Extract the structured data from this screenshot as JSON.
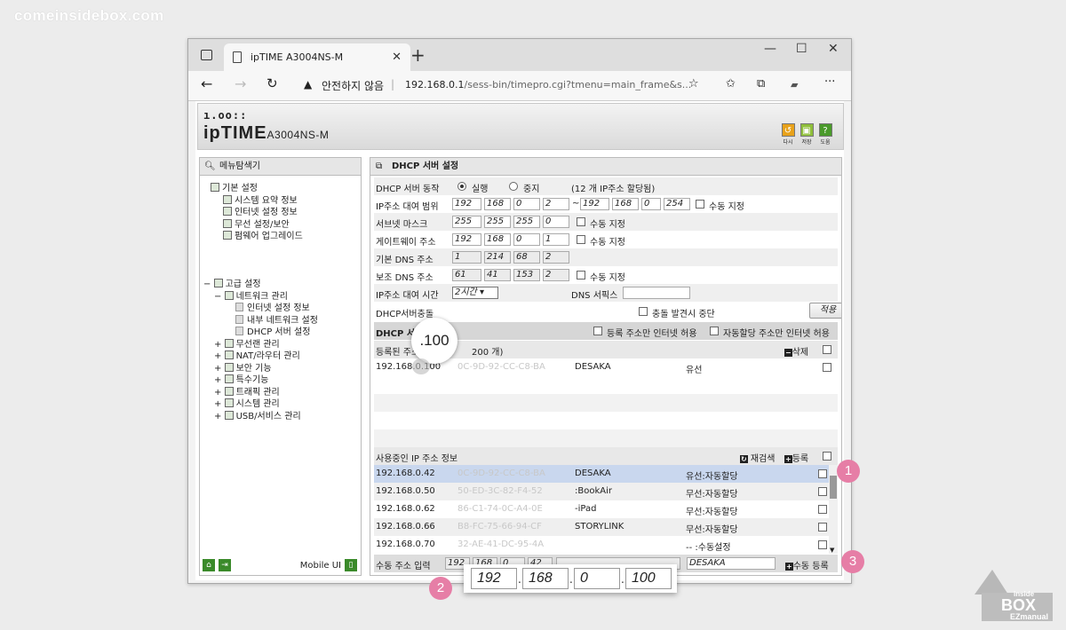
{
  "watermark": "comeinsidebox.com",
  "browser": {
    "tab_title": "ipTIME A3004NS-M",
    "insecure": "안전하지 않음",
    "url_host": "192.168.0.1",
    "url_path": "/sess-bin/timepro.cgi?tmenu=main_frame&s..."
  },
  "header": {
    "logo_top": "ı.oo::",
    "logo_brand": "ipTIME",
    "logo_model": "A3004NS-M",
    "buttons": [
      "다시",
      "저장",
      "도움"
    ]
  },
  "left_panel": {
    "title": "메뉴탐색기",
    "basic": {
      "label": "기본 설정",
      "items": [
        "시스템 요약 정보",
        "인터넷 설정 정보",
        "무선 설정/보안",
        "펌웨어 업그레이드"
      ]
    },
    "advanced": {
      "label": "고급 설정",
      "network": "네트워크 관리",
      "network_items": [
        "인터넷 설정 정보",
        "내부 네트워크 설정",
        "DHCP 서버 설정"
      ],
      "others": [
        "무선랜 관리",
        "NAT/라우터 관리",
        "보안 기능",
        "특수기능",
        "트래픽 관리",
        "시스템 관리",
        "USB/서비스 관리"
      ]
    },
    "mobile": "Mobile UI"
  },
  "right_panel": {
    "title": "DHCP 서버 설정",
    "rows": {
      "dhcp_server": "DHCP 서버 동작",
      "run": "실행",
      "stop": "중지",
      "ip_count": "(12 개 IP주소 할당됨)",
      "range": "IP주소 대여 범위",
      "range_start": [
        "192",
        "168",
        "0",
        "2"
      ],
      "range_end": [
        "192",
        "168",
        "0",
        "254"
      ],
      "manual": "수동 지정",
      "subnet": "서브넷 마스크",
      "subnet_val": [
        "255",
        "255",
        "255",
        "0"
      ],
      "gateway": "게이트웨이 주소",
      "gateway_val": [
        "192",
        "168",
        "0",
        "1"
      ],
      "dns1": "기본 DNS 주소",
      "dns1_val": [
        "1",
        "214",
        "68",
        "2"
      ],
      "dns2": "보조 DNS 주소",
      "dns2_val": [
        "61",
        "41",
        "153",
        "2"
      ],
      "lease": "IP주소 대여 시간",
      "lease_val": "2시간",
      "dns_suffix": "DNS 서픽스",
      "conflict": "DHCP서버충돌",
      "conflict_stop": "충돌 발견시 중단",
      "apply": "적용"
    },
    "band": {
      "left": "DHCP 서버",
      "only_reg": "등록 주소만 인터넷 허용",
      "only_auto": "자동할당 주소만 인터넷 허용"
    },
    "registered": {
      "header_a": "등록된 주소",
      "header_b": "200 개)",
      "delete": "삭제",
      "rows": [
        {
          "ip": "192.168.0.100",
          "mac": "0C-9D-92-CC-C8-BA",
          "name": "DESAKA",
          "type": "유선"
        }
      ]
    },
    "in_use": {
      "title": "사용중인 IP 주소 정보",
      "rescan": "재검색",
      "register": "등록",
      "rows": [
        {
          "ip": "192.168.0.42",
          "mac": "0C-9D-92-CC-C8-BA",
          "name": "DESAKA",
          "type": "유선:자동할당"
        },
        {
          "ip": "192.168.0.50",
          "mac": "50-ED-3C-82-F4-52",
          "name": "Dekaleo-MacBookAir",
          "name_shown": ":BookAir",
          "type": "무선:자동할당"
        },
        {
          "ip": "192.168.0.62",
          "mac": "86-C1-74-0C-A4-0E",
          "name": "Dekaleo-iPad",
          "name_shown": "-iPad",
          "type": "무선:자동할당"
        },
        {
          "ip": "192.168.0.66",
          "mac": "B8-FC-75-66-94-CF",
          "name": "STORYLINK",
          "type": "무선:자동할당"
        },
        {
          "ip": "192.168.0.70",
          "mac": "32-AE-41-DC-95-4A",
          "name": "",
          "type": "-- :수동설정"
        }
      ]
    },
    "manual_input": {
      "label": "수동 주소 입력",
      "ip": [
        "192",
        "168",
        "0",
        "42"
      ],
      "name": "DESAKA",
      "register": "수동 등록"
    }
  },
  "magnifier": ".100",
  "zoom": [
    "192",
    "168",
    "0",
    "100"
  ],
  "badges": [
    "1",
    "2",
    "3"
  ],
  "brand": {
    "line1": "inside",
    "line2": "BOX",
    "line3": "EZmanual"
  }
}
